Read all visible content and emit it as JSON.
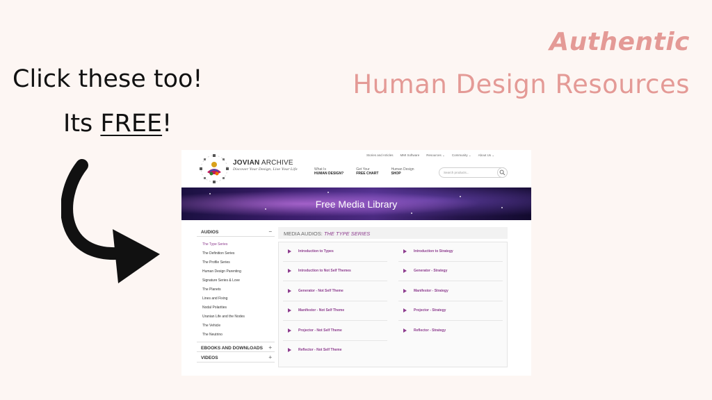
{
  "heading": {
    "line1": "Authentic",
    "line2": "Human Design Resources"
  },
  "callout": {
    "line1": "Click these too!",
    "line2_prefix": "Its ",
    "line2_emph": "FREE",
    "line2_suffix": "!"
  },
  "site": {
    "logo": {
      "name_bold": "JOVIAN",
      "name_rest": " ARCHIVE",
      "tagline": "Discover Your Design, Live Your Life"
    },
    "top_nav": [
      "Stories and Articles",
      "MMI Software",
      "Resources ⌄",
      "Community ⌄",
      "About Us ⌄"
    ],
    "main_nav": [
      {
        "small": "What Is",
        "big": "HUMAN DESIGN?"
      },
      {
        "small": "Get Your",
        "big": "FREE CHART"
      },
      {
        "small": "Human Design",
        "big": "SHOP"
      }
    ],
    "search": {
      "placeholder": "Search products..."
    },
    "banner_title": "Free Media Library",
    "sidebar": {
      "audios_header": "AUDIOS",
      "audios_toggle": "−",
      "audio_items": [
        "The Type Series",
        "The Definition Series",
        "The Profile Series",
        "Human Design Parenting",
        "Signature Series & Love",
        "The Planets",
        "Lines and Fixing",
        "Nodal Polarities",
        "Uranian Life and the Nodes",
        "The Vehicle",
        "The Neutrino"
      ],
      "ebooks_header": "EBOOKS AND DOWNLOADS",
      "ebooks_toggle": "+",
      "videos_header": "VIDEOS",
      "videos_toggle": "+"
    },
    "main": {
      "header_prefix": "MEDIA AUDIOS: ",
      "header_series": "THE TYPE SERIES",
      "tracks_left": [
        "Introduction to Types",
        "Introduction to Not Self Themes",
        "Generator - Not Self Theme",
        "Manifestor - Not Self Theme",
        "Projector - Not Self Theme",
        "Reflector - Not Self Theme"
      ],
      "tracks_right": [
        "Introduction to Strategy",
        "Generator - Strategy",
        "Manifestor - Strategy",
        "Projector - Strategy",
        "Reflector - Strategy"
      ]
    }
  },
  "colors": {
    "accent_pink": "#e49a96",
    "site_purple": "#8d3c8e",
    "background": "#fdf6f3"
  }
}
